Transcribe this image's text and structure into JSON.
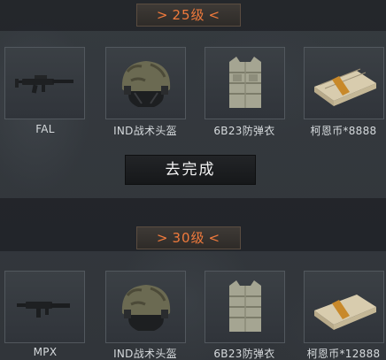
{
  "tiers": [
    {
      "level_label": "25级",
      "rewards": [
        {
          "name": "FAL",
          "icon": "rifle-icon"
        },
        {
          "name": "IND战术头盔",
          "icon": "helmet-icon"
        },
        {
          "name": "6B23防弹衣",
          "icon": "body-armor-icon"
        },
        {
          "name": "柯恩币*8888",
          "icon": "cash-bundle-icon"
        }
      ],
      "action_label": "去完成"
    },
    {
      "level_label": "30级",
      "rewards": [
        {
          "name": "MPX",
          "icon": "smg-icon"
        },
        {
          "name": "IND战术头盔",
          "icon": "helmet-icon"
        },
        {
          "name": "6B23防弹衣",
          "icon": "body-armor-icon"
        },
        {
          "name": "柯恩币*12888",
          "icon": "cash-bundle-icon"
        }
      ]
    }
  ],
  "arrows": {
    "left": ">",
    "right": "<"
  },
  "colors": {
    "accent": "#f07a3c",
    "background": "#34383c",
    "card": "#3b4045"
  }
}
